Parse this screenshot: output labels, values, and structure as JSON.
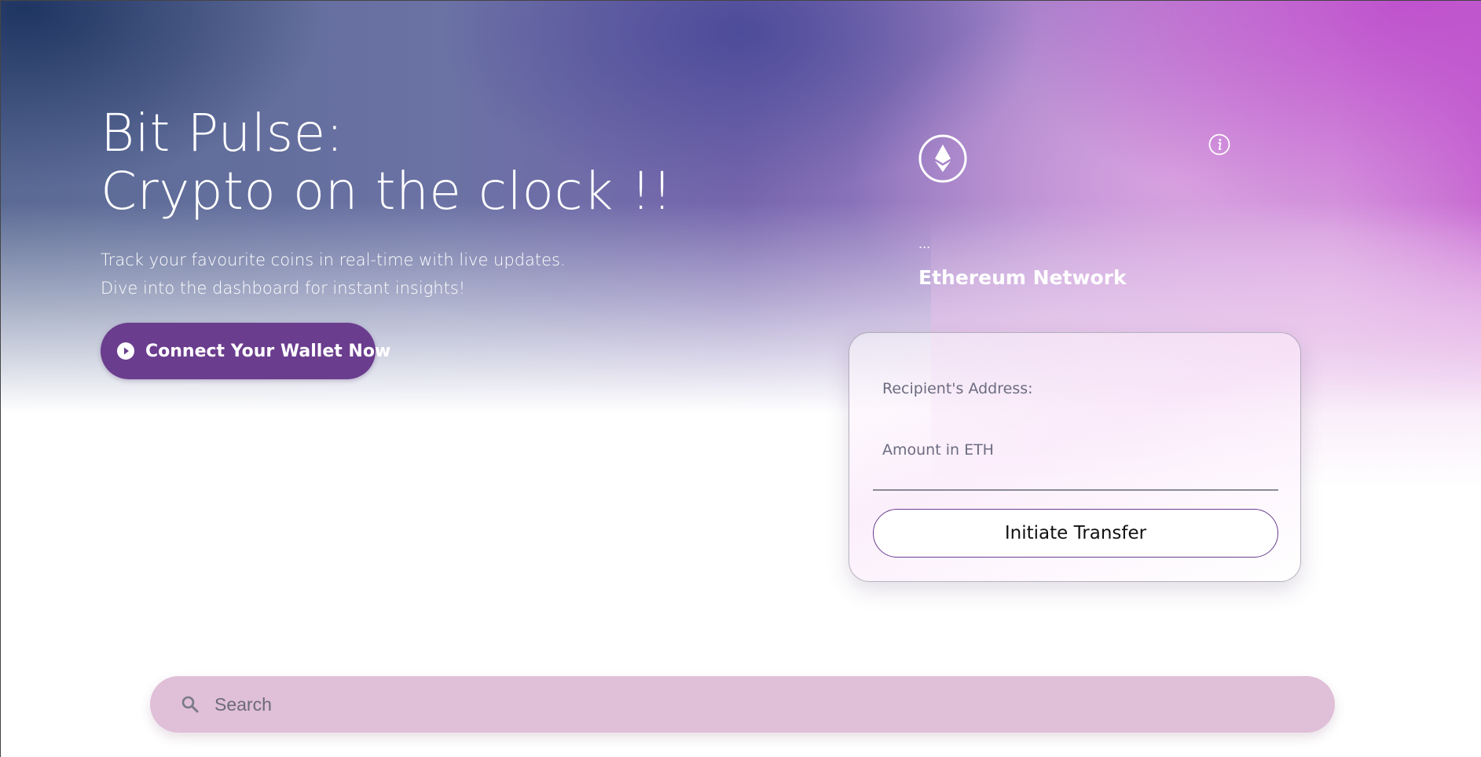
{
  "hero": {
    "title_line1": "Bit Pulse:",
    "title_line2": "Crypto on the clock !!",
    "subtitle_line1": "Track your favourite coins in real-time with live updates.",
    "subtitle_line2": "Dive into the dashboard for instant insights!",
    "connect_label": "Connect Your Wallet Now",
    "connect_icon": "play-circle-icon"
  },
  "wallet_card": {
    "network_icon": "ethereum-icon",
    "info_icon": "info-icon",
    "address": "...",
    "network": "Ethereum Network"
  },
  "transfer_form": {
    "address_placeholder": "Recipient's Address:",
    "amount_placeholder": "Amount in ETH",
    "submit_label": "Initiate Transfer"
  },
  "search": {
    "placeholder": "Search",
    "icon": "search-icon"
  },
  "colors": {
    "primary": "#6a3d8e",
    "search_bg": "#e0bfd8",
    "hero_dark": "#1c325f",
    "hero_pink": "#c86ad2"
  }
}
